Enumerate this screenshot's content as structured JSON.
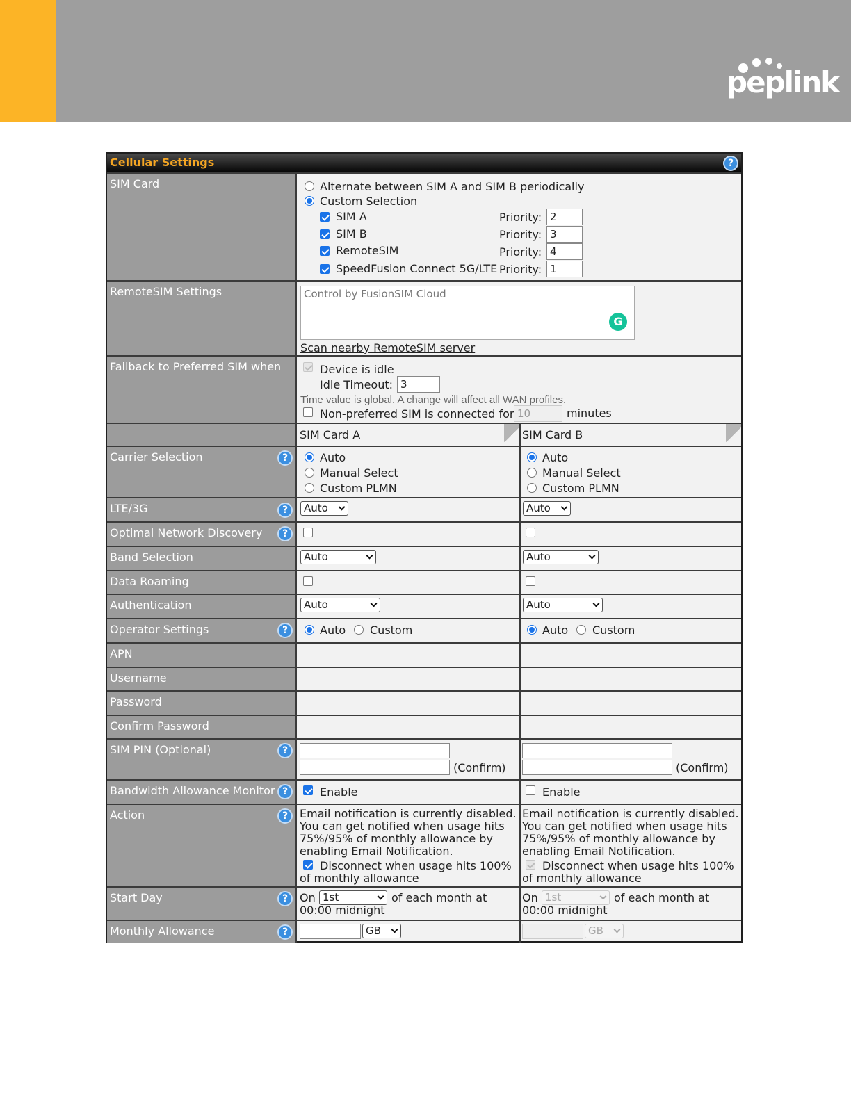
{
  "brand": {
    "name": "peplink",
    "accent_color": "#fcb426",
    "banner_color": "#9e9e9e"
  },
  "panel": {
    "title": "Cellular Settings",
    "title_color": "#f5a623",
    "help_icon": "help-icon"
  },
  "sim_card": {
    "label": "SIM Card",
    "option_alternate": "Alternate between SIM A and SIM B periodically",
    "option_custom": "Custom Selection",
    "selected": "custom",
    "priority_label": "Priority:",
    "sims": [
      {
        "name": "SIM A",
        "checked": true,
        "priority": "2"
      },
      {
        "name": "SIM B",
        "checked": true,
        "priority": "3"
      },
      {
        "name": "RemoteSIM",
        "checked": true,
        "priority": "4"
      },
      {
        "name": "SpeedFusion Connect 5G/LTE",
        "checked": true,
        "priority": "1"
      }
    ]
  },
  "remotesim": {
    "label": "RemoteSIM Settings",
    "placeholder": "Control by FusionSIM Cloud",
    "scan_link": "Scan nearby RemoteSIM server",
    "badge": "G"
  },
  "failback": {
    "label": "Failback to Preferred SIM when",
    "idle_label": "Device is idle",
    "idle_timeout_label": "Idle Timeout:",
    "idle_timeout": "3",
    "global_note": "Time value is global. A change will affect all WAN profiles.",
    "nonpreferred_label": "Non-preferred SIM is connected for",
    "nonpreferred_value": "10",
    "minutes": "minutes"
  },
  "columns": {
    "a": "SIM Card A",
    "b": "SIM Card B"
  },
  "carrier": {
    "label": "Carrier Selection",
    "options": [
      "Auto",
      "Manual Select",
      "Custom PLMN"
    ],
    "a": "Auto",
    "b": "Auto"
  },
  "lte": {
    "label": "LTE/3G",
    "a": "Auto",
    "b": "Auto"
  },
  "optimal": {
    "label": "Optimal Network Discovery",
    "a": false,
    "b": false
  },
  "band": {
    "label": "Band Selection",
    "a": "Auto",
    "b": "Auto"
  },
  "roaming": {
    "label": "Data Roaming",
    "a": false,
    "b": false
  },
  "auth": {
    "label": "Authentication",
    "a": "Auto",
    "b": "Auto"
  },
  "operator": {
    "label": "Operator Settings",
    "auto": "Auto",
    "custom": "Custom",
    "a": "Auto",
    "b": "Auto"
  },
  "apn": {
    "label": "APN"
  },
  "username": {
    "label": "Username"
  },
  "password": {
    "label": "Password"
  },
  "confirm_password": {
    "label": "Confirm Password"
  },
  "sim_pin": {
    "label": "SIM PIN (Optional)",
    "confirm": "(Confirm)"
  },
  "bandwidth": {
    "label": "Bandwidth Allowance Monitor",
    "enable": "Enable",
    "a": true,
    "b": false
  },
  "action": {
    "label": "Action",
    "line1": "Email notification is currently disabled.",
    "line2": "You can get notified when usage hits",
    "line3": "75%/95% of monthly allowance by",
    "line4_prefix": "enabling",
    "line4_link": "Email Notification",
    "line4_suffix": ".",
    "disconnect_line1": "Disconnect when usage hits 100%",
    "disconnect_line2": "of monthly allowance",
    "a_checked": true,
    "b_checked": true
  },
  "start_day": {
    "label": "Start Day",
    "on": "On",
    "day": "1st",
    "suffix": "of each month at",
    "time": "00:00 midnight"
  },
  "monthly": {
    "label": "Monthly Allowance",
    "unit": "GB"
  }
}
